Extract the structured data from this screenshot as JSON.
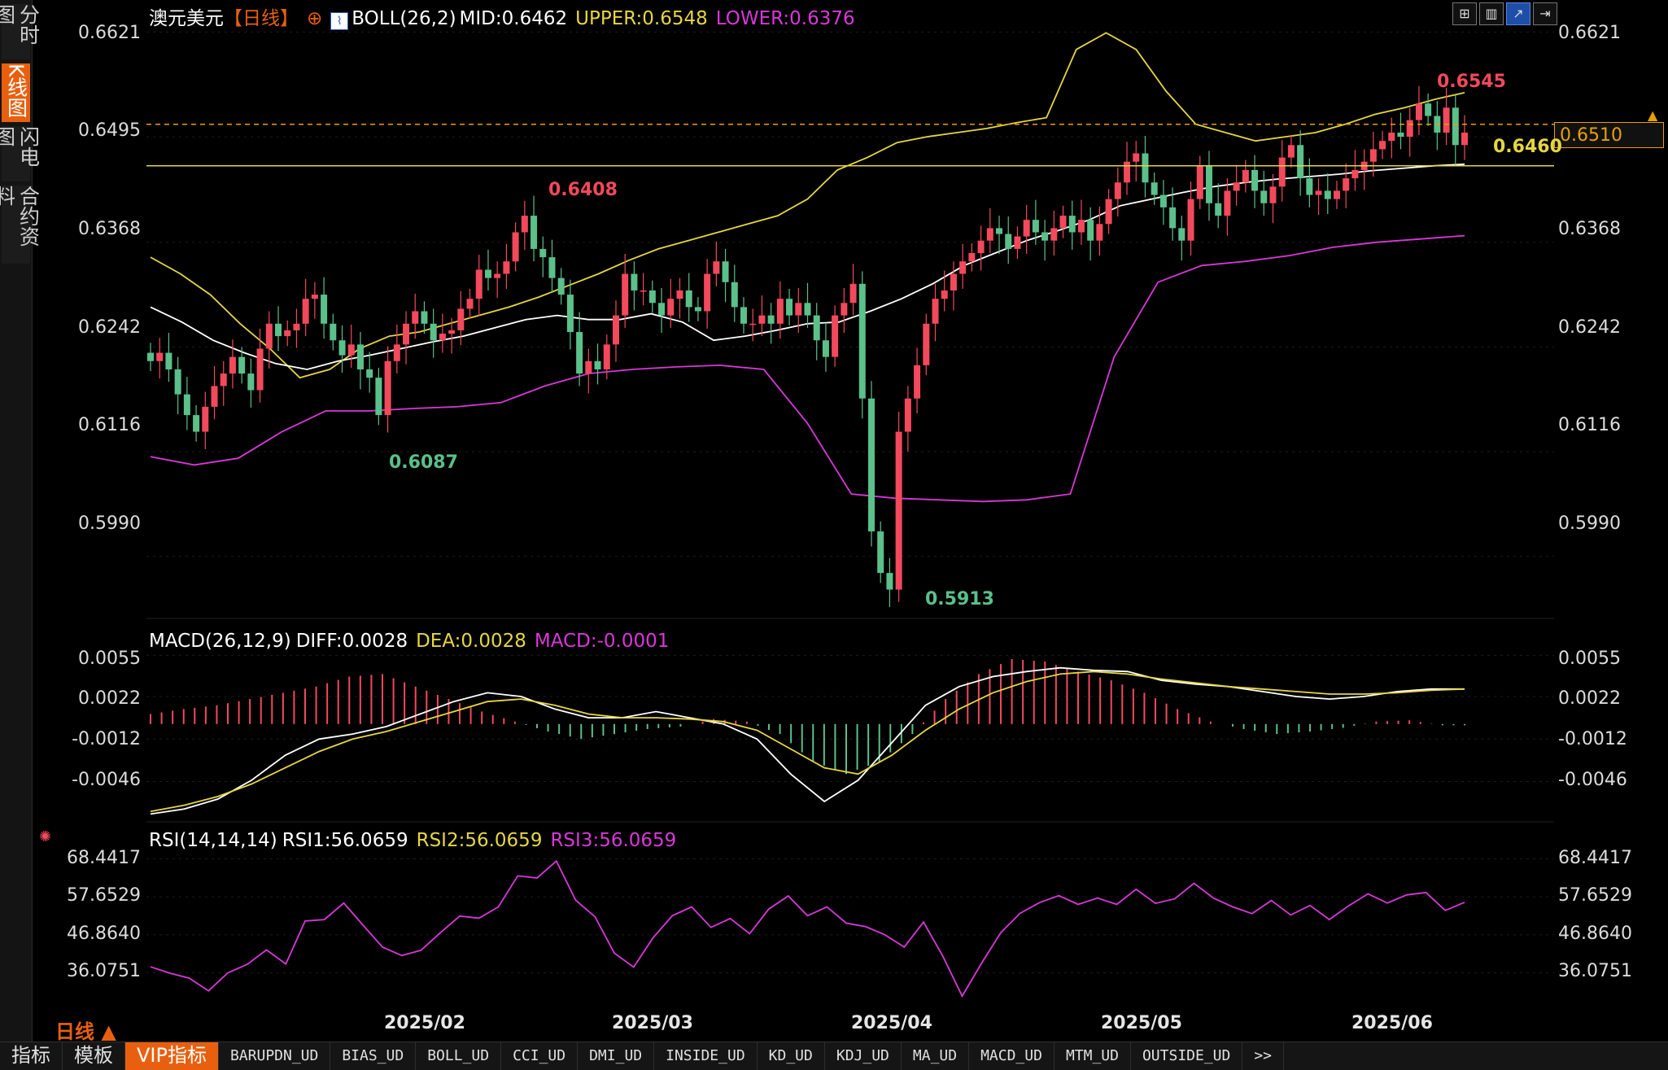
{
  "sidebar": {
    "tabs": [
      {
        "label": "分时图",
        "active": false
      },
      {
        "label": "K线图",
        "active": true
      },
      {
        "label": "闪电图",
        "active": false
      },
      {
        "label": "合约资料",
        "active": false
      }
    ]
  },
  "main_header": {
    "symbol": "澳元美元",
    "period": "【日线】",
    "indicator": "BOLL(26,2)",
    "mid": "MID:0.6462",
    "upper": "UPPER:0.6548",
    "lower": "LOWER:0.6376"
  },
  "macd_header": {
    "name": "MACD(26,12,9)",
    "diff": "DIFF:0.0028",
    "dea": "DEA:0.0028",
    "macd": "MACD:-0.0001"
  },
  "rsi_header": {
    "name": "RSI(14,14,14)",
    "rsi1": "RSI1:56.0659",
    "rsi2": "RSI2:56.0659",
    "rsi3": "RSI3:56.0659"
  },
  "toolbar_icons": [
    "grid-icon",
    "bar-chart-icon",
    "line-chart-icon",
    "crosshair-icon"
  ],
  "price_labels": {
    "high_mark": "0.6545",
    "feb_high": "0.6408",
    "feb_low": "0.6087",
    "apr_low": "0.5913",
    "hline_value": "0.6460",
    "last_price": "0.6510"
  },
  "period_label": "日线 ▲",
  "bottom_bar": {
    "buttons": [
      "指标",
      "模板",
      "VIP指标",
      "BARUPDN_UD",
      "BIAS_UD",
      "BOLL_UD",
      "CCI_UD",
      "DMI_UD",
      "INSIDE_UD",
      "KD_UD",
      "KDJ_UD",
      "MA_UD",
      "MACD_UD",
      "MTM_UD",
      "OUTSIDE_UD",
      ">>"
    ],
    "active": "VIP指标"
  },
  "colors": {
    "up": "#f2495c",
    "down": "#5bc08a",
    "boll_mid": "#ffffff",
    "boll_upper": "#e6d640",
    "boll_lower": "#d838d8",
    "accent": "#e8600f"
  },
  "chart_data": [
    {
      "type": "candlestick",
      "title": "澳元美元【日线】",
      "x_categories": [
        "2025/02",
        "2025/03",
        "2025/04",
        "2025/05",
        "2025/06"
      ],
      "y_ticks": [
        "0.6621",
        "0.6495",
        "0.6368",
        "0.6242",
        "0.6116",
        "0.5990"
      ],
      "ylim": [
        0.593,
        0.664
      ],
      "annotated_points": [
        {
          "label": "0.6408",
          "type": "high",
          "approx_date": "2025/02 mid"
        },
        {
          "label": "0.6087",
          "type": "low",
          "approx_date": "2025/02 start"
        },
        {
          "label": "0.5913",
          "type": "low",
          "approx_date": "2025/04 early"
        },
        {
          "label": "0.6545",
          "type": "high",
          "approx_date": "2025/06 late"
        }
      ],
      "horizontal_lines": [
        {
          "value": 0.646,
          "label": "0.6460",
          "style": "solid",
          "color": "#e6d640"
        },
        {
          "value": 0.651,
          "label": "0.6510",
          "style": "dashed",
          "color": "#e8a000"
        }
      ],
      "closes": [
        0.6225,
        0.6235,
        0.6215,
        0.6185,
        0.616,
        0.614,
        0.617,
        0.6195,
        0.621,
        0.623,
        0.621,
        0.619,
        0.624,
        0.627,
        0.6255,
        0.6262,
        0.627,
        0.63,
        0.6305,
        0.627,
        0.625,
        0.6232,
        0.6245,
        0.6215,
        0.6205,
        0.616,
        0.6225,
        0.6245,
        0.627,
        0.6285,
        0.627,
        0.625,
        0.6258,
        0.6262,
        0.6288,
        0.63,
        0.6335,
        0.6325,
        0.633,
        0.6345,
        0.638,
        0.64,
        0.636,
        0.635,
        0.6325,
        0.6305,
        0.626,
        0.621,
        0.6225,
        0.6215,
        0.6245,
        0.628,
        0.633,
        0.631,
        0.631,
        0.6295,
        0.628,
        0.63,
        0.631,
        0.629,
        0.6285,
        0.633,
        0.6345,
        0.632,
        0.629,
        0.627,
        0.627,
        0.628,
        0.627,
        0.63,
        0.628,
        0.6295,
        0.628,
        0.625,
        0.623,
        0.628,
        0.6295,
        0.6318,
        0.618,
        0.602,
        0.597,
        0.595,
        0.614,
        0.618,
        0.622,
        0.627,
        0.63,
        0.631,
        0.633,
        0.6345,
        0.6355,
        0.637,
        0.6385,
        0.6378,
        0.636,
        0.6375,
        0.6395,
        0.638,
        0.637,
        0.6385,
        0.64,
        0.638,
        0.6395,
        0.637,
        0.639,
        0.642,
        0.644,
        0.6465,
        0.6475,
        0.644,
        0.6425,
        0.641,
        0.6385,
        0.637,
        0.642,
        0.646,
        0.6415,
        0.64,
        0.643,
        0.644,
        0.6455,
        0.643,
        0.6415,
        0.6435,
        0.647,
        0.6485,
        0.6445,
        0.6425,
        0.643,
        0.642,
        0.643,
        0.6445,
        0.6455,
        0.6465,
        0.648,
        0.649,
        0.65,
        0.6495,
        0.6515,
        0.6535,
        0.652,
        0.65,
        0.653,
        0.6485,
        0.65
      ],
      "boll_upper": [
        0.635,
        0.633,
        0.6305,
        0.627,
        0.624,
        0.6205,
        0.6215,
        0.624,
        0.6255,
        0.626,
        0.627,
        0.628,
        0.629,
        0.6302,
        0.6316,
        0.633,
        0.6346,
        0.636,
        0.637,
        0.638,
        0.639,
        0.64,
        0.642,
        0.6455,
        0.647,
        0.6488,
        0.6495,
        0.65,
        0.6505,
        0.6512,
        0.6518,
        0.66,
        0.662,
        0.66,
        0.655,
        0.651,
        0.65,
        0.649,
        0.6495,
        0.65,
        0.651,
        0.6522,
        0.653,
        0.654,
        0.6548
      ],
      "boll_mid": [
        0.629,
        0.6272,
        0.625,
        0.6235,
        0.6222,
        0.6215,
        0.6225,
        0.6232,
        0.624,
        0.6248,
        0.6255,
        0.6265,
        0.6275,
        0.628,
        0.6275,
        0.6275,
        0.6282,
        0.6272,
        0.625,
        0.6255,
        0.6262,
        0.627,
        0.6272,
        0.6285,
        0.63,
        0.6318,
        0.634,
        0.6355,
        0.637,
        0.6382,
        0.6395,
        0.6412,
        0.642,
        0.6428,
        0.6435,
        0.644,
        0.6444,
        0.6447,
        0.645,
        0.6454,
        0.6457,
        0.646,
        0.6462
      ],
      "boll_lower": [
        0.611,
        0.61,
        0.6108,
        0.614,
        0.6165,
        0.6165,
        0.6168,
        0.617,
        0.6175,
        0.6195,
        0.621,
        0.6215,
        0.6218,
        0.622,
        0.6215,
        0.615,
        0.6065,
        0.606,
        0.6058,
        0.6056,
        0.6058,
        0.6065,
        0.623,
        0.632,
        0.634,
        0.6345,
        0.6352,
        0.6362,
        0.6368,
        0.6372,
        0.6376
      ]
    },
    {
      "type": "line",
      "title": "MACD(26,12,9)",
      "y_ticks": [
        "0.0055",
        "0.0022",
        "-0.0012",
        "-0.0046"
      ],
      "ylim": [
        -0.0075,
        0.0065
      ],
      "series": [
        {
          "name": "DIFF",
          "color": "#ffffff",
          "values": [
            -0.0072,
            -0.0068,
            -0.006,
            -0.0045,
            -0.0025,
            -0.0012,
            -0.0008,
            -0.0002,
            0.0008,
            0.0018,
            0.0025,
            0.0022,
            0.0012,
            0.0005,
            0.0005,
            0.001,
            0.0005,
            0.0,
            -0.0012,
            -0.004,
            -0.0062,
            -0.0045,
            -0.0015,
            0.0015,
            0.003,
            0.0038,
            0.0042,
            0.0045,
            0.0043,
            0.0042,
            0.0035,
            0.0032,
            0.003,
            0.0026,
            0.0022,
            0.002,
            0.0022,
            0.0026,
            0.0028,
            0.0028
          ]
        },
        {
          "name": "DEA",
          "color": "#e6d640",
          "values": [
            -0.007,
            -0.0065,
            -0.0058,
            -0.0048,
            -0.0035,
            -0.0022,
            -0.0012,
            -0.0006,
            0.0002,
            0.001,
            0.0018,
            0.002,
            0.0015,
            0.0008,
            0.0005,
            0.0005,
            0.0004,
            0.0002,
            -0.0005,
            -0.002,
            -0.0035,
            -0.004,
            -0.0025,
            -0.0005,
            0.0012,
            0.0025,
            0.0034,
            0.004,
            0.0042,
            0.004,
            0.0036,
            0.0033,
            0.003,
            0.0028,
            0.0026,
            0.0024,
            0.0024,
            0.0025,
            0.0027,
            0.0028
          ]
        },
        {
          "name": "MACD",
          "color": "#d838d8",
          "values": [
            0.0008,
            0.0012,
            0.0015,
            0.002,
            0.0025,
            0.003,
            0.0038,
            0.004,
            0.003,
            0.002,
            0.001,
            0.0002,
            -0.0006,
            -0.0012,
            -0.0008,
            -0.0004,
            -0.0002,
            0.0004,
            0.0002,
            -0.0008,
            -0.003,
            -0.004,
            -0.003,
            -0.0008,
            0.002,
            0.004,
            0.0052,
            0.005,
            0.0042,
            0.0035,
            0.0025,
            0.0012,
            0.0002,
            -0.0004,
            -0.0008,
            -0.0006,
            -0.0003,
            0.0002,
            0.0003,
            -0.0001
          ]
        }
      ]
    },
    {
      "type": "line",
      "title": "RSI(14,14,14)",
      "y_ticks": [
        "68.4417",
        "57.6529",
        "46.8640",
        "36.0751"
      ],
      "ylim": [
        27.0,
        72.0
      ],
      "series": [
        {
          "name": "RSI",
          "color": "#d838d8",
          "values": [
            37.8,
            36.0,
            34.6,
            31.0,
            36.1,
            38.5,
            42.6,
            38.6,
            50.8,
            51.2,
            55.9,
            49.6,
            43.4,
            41.0,
            42.5,
            47.5,
            52.2,
            51.6,
            54.8,
            63.6,
            63.0,
            67.8,
            56.7,
            52.0,
            41.7,
            37.7,
            46.0,
            52.3,
            54.8,
            49.0,
            51.5,
            47.2,
            54.2,
            57.9,
            52.3,
            54.8,
            50.2,
            49.2,
            46.9,
            43.4,
            50.5,
            40.8,
            29.5,
            38.8,
            47.5,
            53.0,
            56.0,
            58.0,
            55.5,
            57.3,
            55.5,
            59.8,
            55.8,
            57.1,
            61.5,
            57.3,
            54.8,
            52.9,
            56.6,
            52.5,
            55.2,
            51.2,
            55.1,
            58.5,
            55.9,
            58.2,
            58.9,
            53.8,
            56.1
          ]
        }
      ]
    }
  ]
}
